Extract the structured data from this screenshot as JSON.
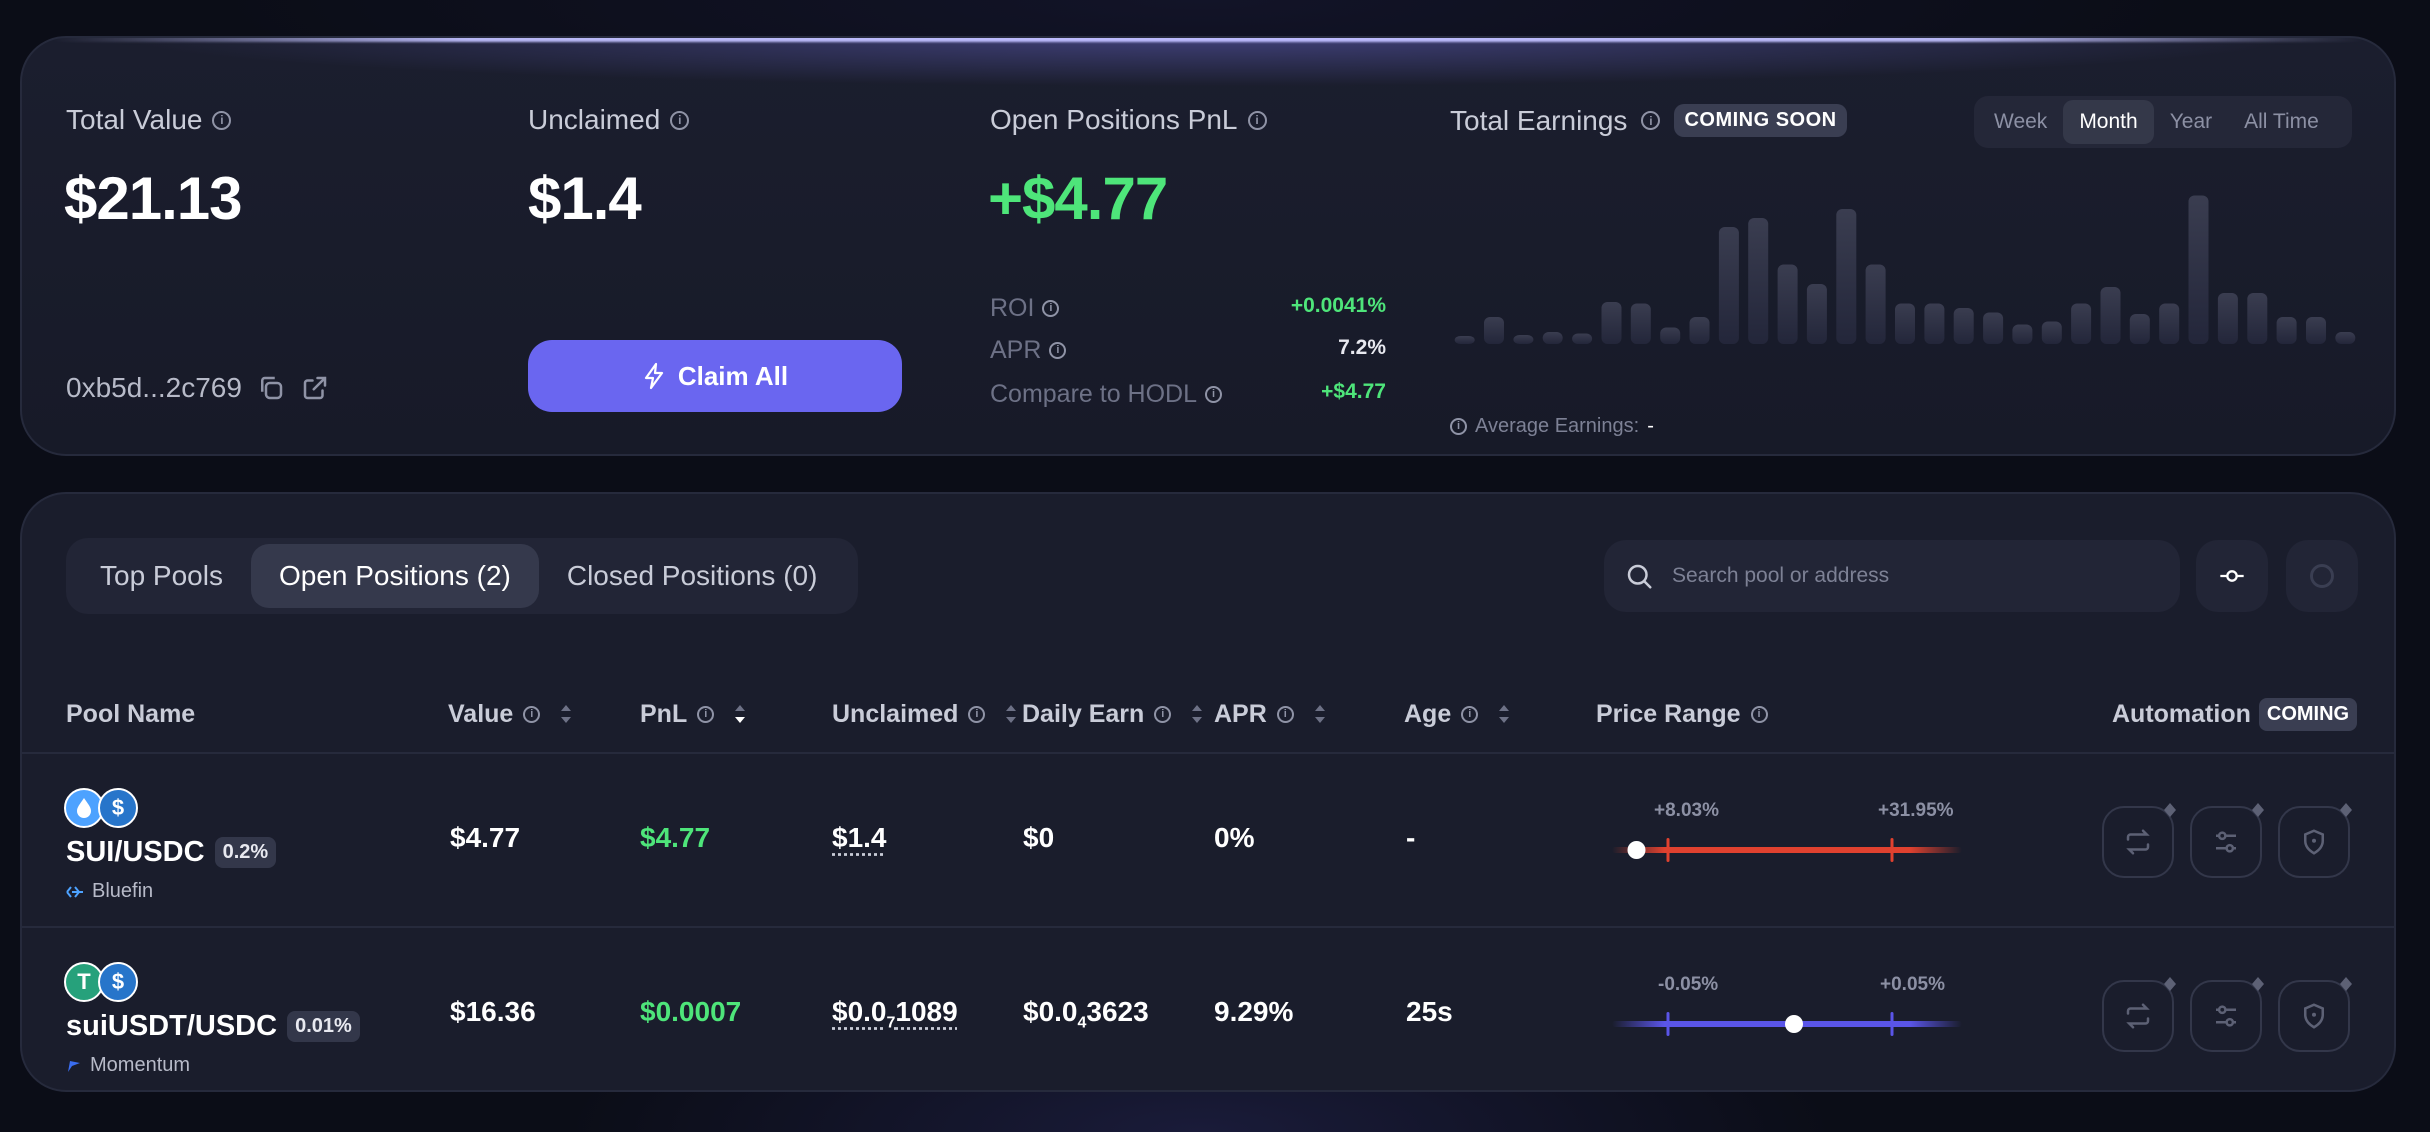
{
  "summary": {
    "total_value": {
      "label": "Total Value",
      "value": "$21.13"
    },
    "unclaimed": {
      "label": "Unclaimed",
      "value": "$1.4"
    },
    "open_pnl": {
      "label": "Open Positions PnL",
      "value": "+$4.77",
      "rows": [
        {
          "label": "ROI",
          "value": "+0.0041%",
          "color": "green"
        },
        {
          "label": "APR",
          "value": "7.2%",
          "color": "white"
        },
        {
          "label": "Compare to HODL",
          "value": "+$4.77",
          "color": "green"
        }
      ]
    },
    "wallet_address": "0xb5d...2c769",
    "claim_button": "Claim All"
  },
  "earnings": {
    "label": "Total Earnings",
    "badge": "COMING SOON",
    "periods": [
      "Week",
      "Month",
      "Year",
      "All Time"
    ],
    "active_period": "Month",
    "average_label": "Average Earnings:",
    "average_value": "-",
    "bar_levels": [
      0.05,
      0.18,
      0.06,
      0.08,
      0.07,
      0.28,
      0.27,
      0.11,
      0.18,
      0.78,
      0.84,
      0.53,
      0.4,
      0.9,
      0.53,
      0.27,
      0.27,
      0.24,
      0.21,
      0.13,
      0.15,
      0.27,
      0.38,
      0.2,
      0.27,
      0.99,
      0.34,
      0.34,
      0.18,
      0.18,
      0.08
    ]
  },
  "tabs": {
    "items": [
      "Top Pools",
      "Open Positions (2)",
      "Closed Positions (0)"
    ],
    "active": "Open Positions (2)"
  },
  "search": {
    "placeholder": "Search pool or address"
  },
  "table": {
    "headers": {
      "pool": "Pool Name",
      "value": "Value",
      "pnl": "PnL",
      "unclaimed": "Unclaimed",
      "daily": "Daily Earn",
      "apr": "APR",
      "age": "Age",
      "range": "Price Range",
      "automation": "Automation",
      "automation_badge": "COMING"
    },
    "rows": [
      {
        "pool": "SUI/USDC",
        "fee": "0.2%",
        "dex": "Bluefin",
        "value": "$4.77",
        "pnl": "$4.77",
        "unclaimed": "$1.4",
        "daily": "$0",
        "apr": "0%",
        "age": "-",
        "range_low": "+8.03%",
        "range_high": "+31.95%",
        "range_color": "#e0412f",
        "price_marker_fraction": 0.07
      },
      {
        "pool": "suiUSDT/USDC",
        "fee": "0.01%",
        "dex": "Momentum",
        "value": "$16.36",
        "pnl": "$0.0007",
        "unclaimed_parts": [
          "$0.0",
          "7",
          "1089"
        ],
        "daily_parts": [
          "$0.0",
          "4",
          "3623"
        ],
        "apr": "9.29%",
        "age": "25s",
        "range_low": "-0.05%",
        "range_high": "+0.05%",
        "range_color": "#5a55e8",
        "price_marker_fraction": 0.52
      }
    ]
  },
  "colors": {
    "accent": "#6a66f0",
    "positive": "#4ee57a",
    "card": "#1a1d2c"
  }
}
